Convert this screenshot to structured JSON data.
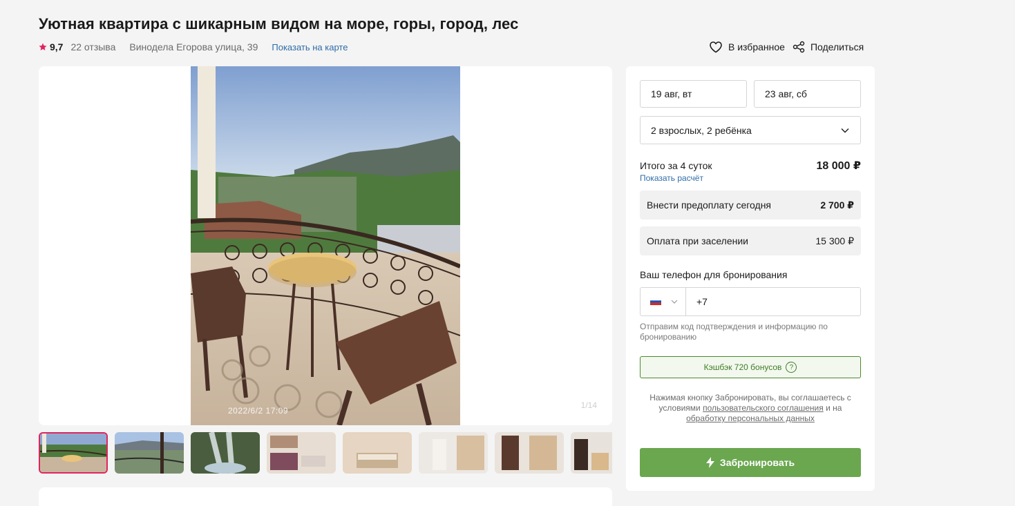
{
  "listing": {
    "title": "Уютная квартира с шикарным видом на море, горы, город, лес",
    "rating": "9,7",
    "reviews": "22 отзыва",
    "address": "Винодела Егорова улица, 39",
    "map_link": "Показать на карте"
  },
  "actions": {
    "favorite": "В избранное",
    "share": "Поделиться"
  },
  "gallery": {
    "photo_timestamp": "2022/6/2 17:09",
    "counter": "1/14",
    "thumbnails": [
      "balcony-view",
      "city-view",
      "waterfall",
      "kitchen",
      "bedroom",
      "hallway",
      "wardrobe",
      "living-room"
    ]
  },
  "booking": {
    "checkin": "19 авг, вт",
    "checkout": "23 авг, сб",
    "guests": "2 взрослых, 2 ребёнка",
    "total_label": "Итого за 4 суток",
    "total_value": "18 000 ₽",
    "calc_link": "Показать расчёт",
    "prepay_label": "Внести предоплату сегодня",
    "prepay_value": "2 700 ₽",
    "checkin_pay_label": "Оплата при заселении",
    "checkin_pay_value": "15 300 ₽",
    "phone_label": "Ваш телефон для бронирования",
    "phone_value": "+7",
    "phone_hint": "Отправим код подтверждения и информацию по бронированию",
    "cashback": "Кэшбэк 720 бонусов",
    "cashback_q": "?",
    "agree_prefix": "Нажимая кнопку Забронировать, вы соглашаетесь с условиями",
    "agree_link1": "пользовательского соглашения",
    "agree_mid": "и на",
    "agree_link2": "обработку персональных данных",
    "book_button": "Забронировать"
  },
  "colors": {
    "accent_green": "#6aa74f",
    "link_blue": "#2e6ca8",
    "rating_star": "#e0245e"
  }
}
